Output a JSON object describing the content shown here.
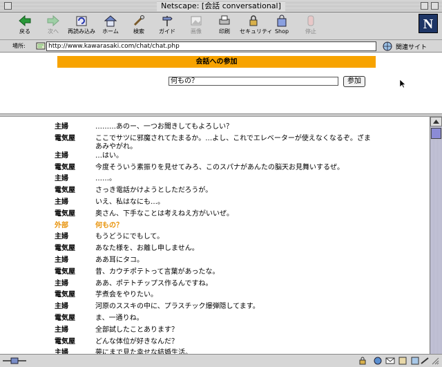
{
  "window": {
    "title": "Netscape: [会話 conversational]"
  },
  "toolbar": {
    "buttons": [
      {
        "label": "戻る",
        "icon": "back-arrow-icon",
        "enabled": true
      },
      {
        "label": "次へ",
        "icon": "forward-arrow-icon",
        "enabled": false
      },
      {
        "label": "再読み込み",
        "icon": "reload-icon",
        "enabled": true
      },
      {
        "label": "ホーム",
        "icon": "home-icon",
        "enabled": true
      },
      {
        "label": "検索",
        "icon": "search-icon",
        "enabled": true
      },
      {
        "label": "ガイド",
        "icon": "guide-icon",
        "enabled": true
      },
      {
        "label": "画像",
        "icon": "images-icon",
        "enabled": false
      },
      {
        "label": "印刷",
        "icon": "print-icon",
        "enabled": true
      },
      {
        "label": "セキュリティ",
        "icon": "security-icon",
        "enabled": true
      },
      {
        "label": "Shop",
        "icon": "shop-icon",
        "enabled": true
      },
      {
        "label": "停止",
        "icon": "stop-icon",
        "enabled": false
      }
    ],
    "logo": "N"
  },
  "location": {
    "label": "場所:",
    "url": "http://www.kawarasaki.com/chat/chat.php",
    "related_label": "関連サイト"
  },
  "join": {
    "header": "会話への参加",
    "input_value": "何もの？",
    "button_label": "参加"
  },
  "chat": {
    "messages": [
      {
        "speaker": "主婦",
        "text": "………あのー、一つお聞きしてもよろしい？"
      },
      {
        "speaker": "電気屋",
        "text": "ここでサツに邪魔されてたまるか。…よし、これでエレベーターが使えなくなるぞ。ざまあみやがれ。"
      },
      {
        "speaker": "主婦",
        "text": "…はい。"
      },
      {
        "speaker": "電気屋",
        "text": "今度そういう素振りを見せてみろ、このスパナがあんたの脳天お見舞いするぜ。"
      },
      {
        "speaker": "主婦",
        "text": "……。"
      },
      {
        "speaker": "電気屋",
        "text": "さっき電話かけようとしただろうが。"
      },
      {
        "speaker": "主婦",
        "text": "いえ、私はなにも…。"
      },
      {
        "speaker": "電気屋",
        "text": "奥さん、下手なことは考えねえ方がいいぜ。"
      },
      {
        "speaker": "外部",
        "text": "何もの？",
        "highlight": true
      },
      {
        "speaker": "主婦",
        "text": "もうどうにでもして。"
      },
      {
        "speaker": "電気屋",
        "text": "あなた様を、お離し申しません。"
      },
      {
        "speaker": "主婦",
        "text": "ああ耳にタコ。"
      },
      {
        "speaker": "電気屋",
        "text": "昔、カウチポテトって言葉があったな。"
      },
      {
        "speaker": "主婦",
        "text": "ああ、ポテトチップス作るんですね。"
      },
      {
        "speaker": "電気屋",
        "text": "芋煮会をやりたい。"
      },
      {
        "speaker": "主婦",
        "text": "河原のススキの中に、プラスチック爆弾隠してます。"
      },
      {
        "speaker": "電気屋",
        "text": "ま、一通りね。"
      },
      {
        "speaker": "主婦",
        "text": "全部試したことあります？"
      },
      {
        "speaker": "電気屋",
        "text": "どんな体位が好きなんだ？"
      },
      {
        "speaker": "主婦",
        "text": "夢にまで見た幸せな結婚生活。"
      }
    ],
    "highlight_color": "#e8930a"
  },
  "colors": {
    "join_bar": "#f7a300",
    "logo_bg": "#1e3565",
    "scroll_thumb": "#8b8bd6"
  }
}
